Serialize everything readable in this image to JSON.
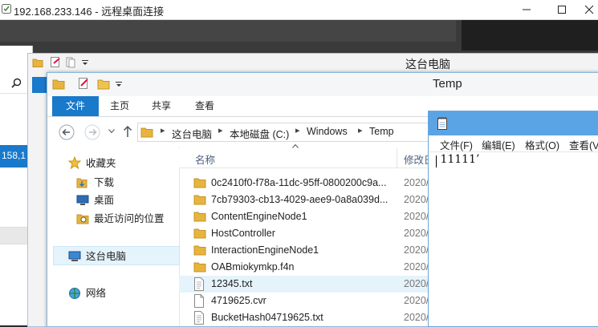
{
  "rdp": {
    "title": "192.168.233.146 - 远程桌面连接"
  },
  "background": {
    "left_fragment": "158,1"
  },
  "back_explorer": {
    "title": "这台电脑"
  },
  "explorer": {
    "title": "Temp",
    "ribbon_tabs": [
      "文件",
      "主页",
      "共享",
      "查看"
    ],
    "breadcrumb": [
      "这台电脑",
      "本地磁盘 (C:)",
      "Windows",
      "Temp"
    ],
    "nav": {
      "favorites": "收藏夹",
      "downloads": "下载",
      "desktop": "桌面",
      "recent": "最近访问的位置",
      "this_pc": "这台电脑",
      "network": "网络"
    },
    "columns": {
      "name": "名称",
      "modified": "修改日"
    },
    "files": [
      {
        "name": "0c2410f0-f78a-11dc-95ff-0800200c9a...",
        "date": "2020/",
        "type": "folder"
      },
      {
        "name": "7cb79303-cb13-4029-aee9-0a8a039d...",
        "date": "2020/",
        "type": "folder"
      },
      {
        "name": "ContentEngineNode1",
        "date": "2020/",
        "type": "folder"
      },
      {
        "name": "HostController",
        "date": "2020/",
        "type": "folder"
      },
      {
        "name": "InteractionEngineNode1",
        "date": "2020/",
        "type": "folder"
      },
      {
        "name": "OABmiokymkp.f4n",
        "date": "2020/",
        "type": "folder"
      },
      {
        "name": "12345.txt",
        "date": "2020/",
        "type": "txt"
      },
      {
        "name": "4719625.cvr",
        "date": "2020/",
        "type": "file"
      },
      {
        "name": "BucketHash04719625.txt",
        "date": "2020/",
        "type": "txt"
      }
    ]
  },
  "notepad": {
    "menu": [
      "文件(F)",
      "编辑(E)",
      "格式(O)",
      "查看(V"
    ],
    "content": " 11111’"
  }
}
